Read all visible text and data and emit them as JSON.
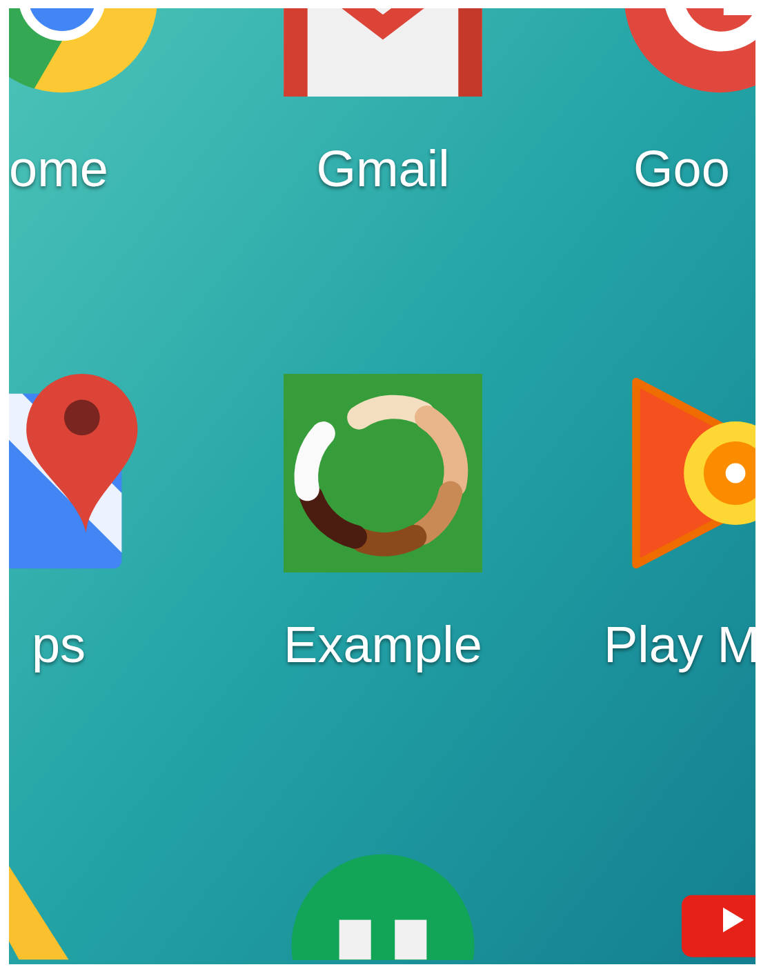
{
  "home_screen": {
    "rows": [
      {
        "apps": [
          {
            "label": "ome"
          },
          {
            "label": "Gmail"
          },
          {
            "label": "Goo"
          }
        ]
      },
      {
        "apps": [
          {
            "label": "ps"
          },
          {
            "label": "Example"
          },
          {
            "label": "Play M"
          }
        ]
      }
    ]
  }
}
